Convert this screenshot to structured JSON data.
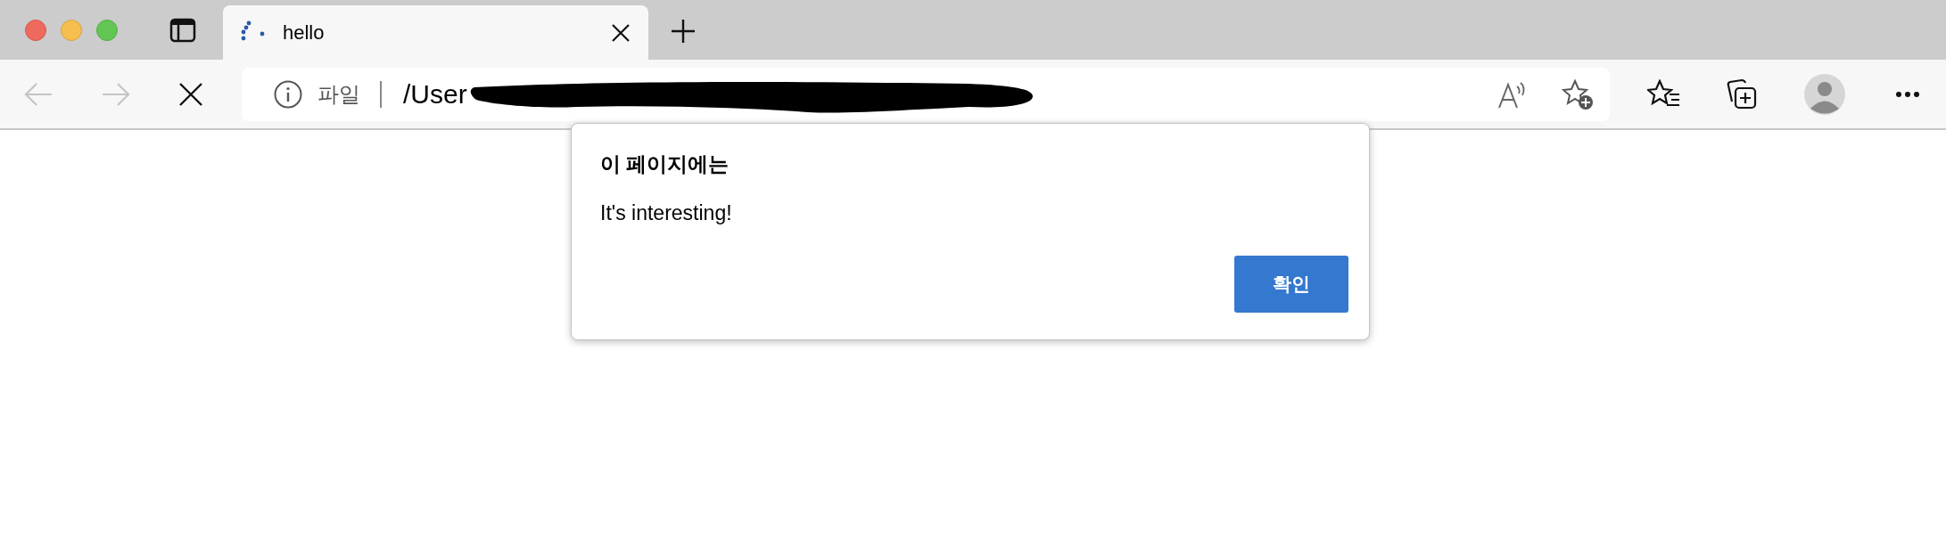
{
  "tabs": [
    {
      "title": "hello",
      "selected": true
    }
  ],
  "address_bar": {
    "scheme_label": "파일",
    "path": "/User"
  },
  "dialog": {
    "title": "이 페이지에는",
    "message": "It's interesting!",
    "button": "확인"
  }
}
